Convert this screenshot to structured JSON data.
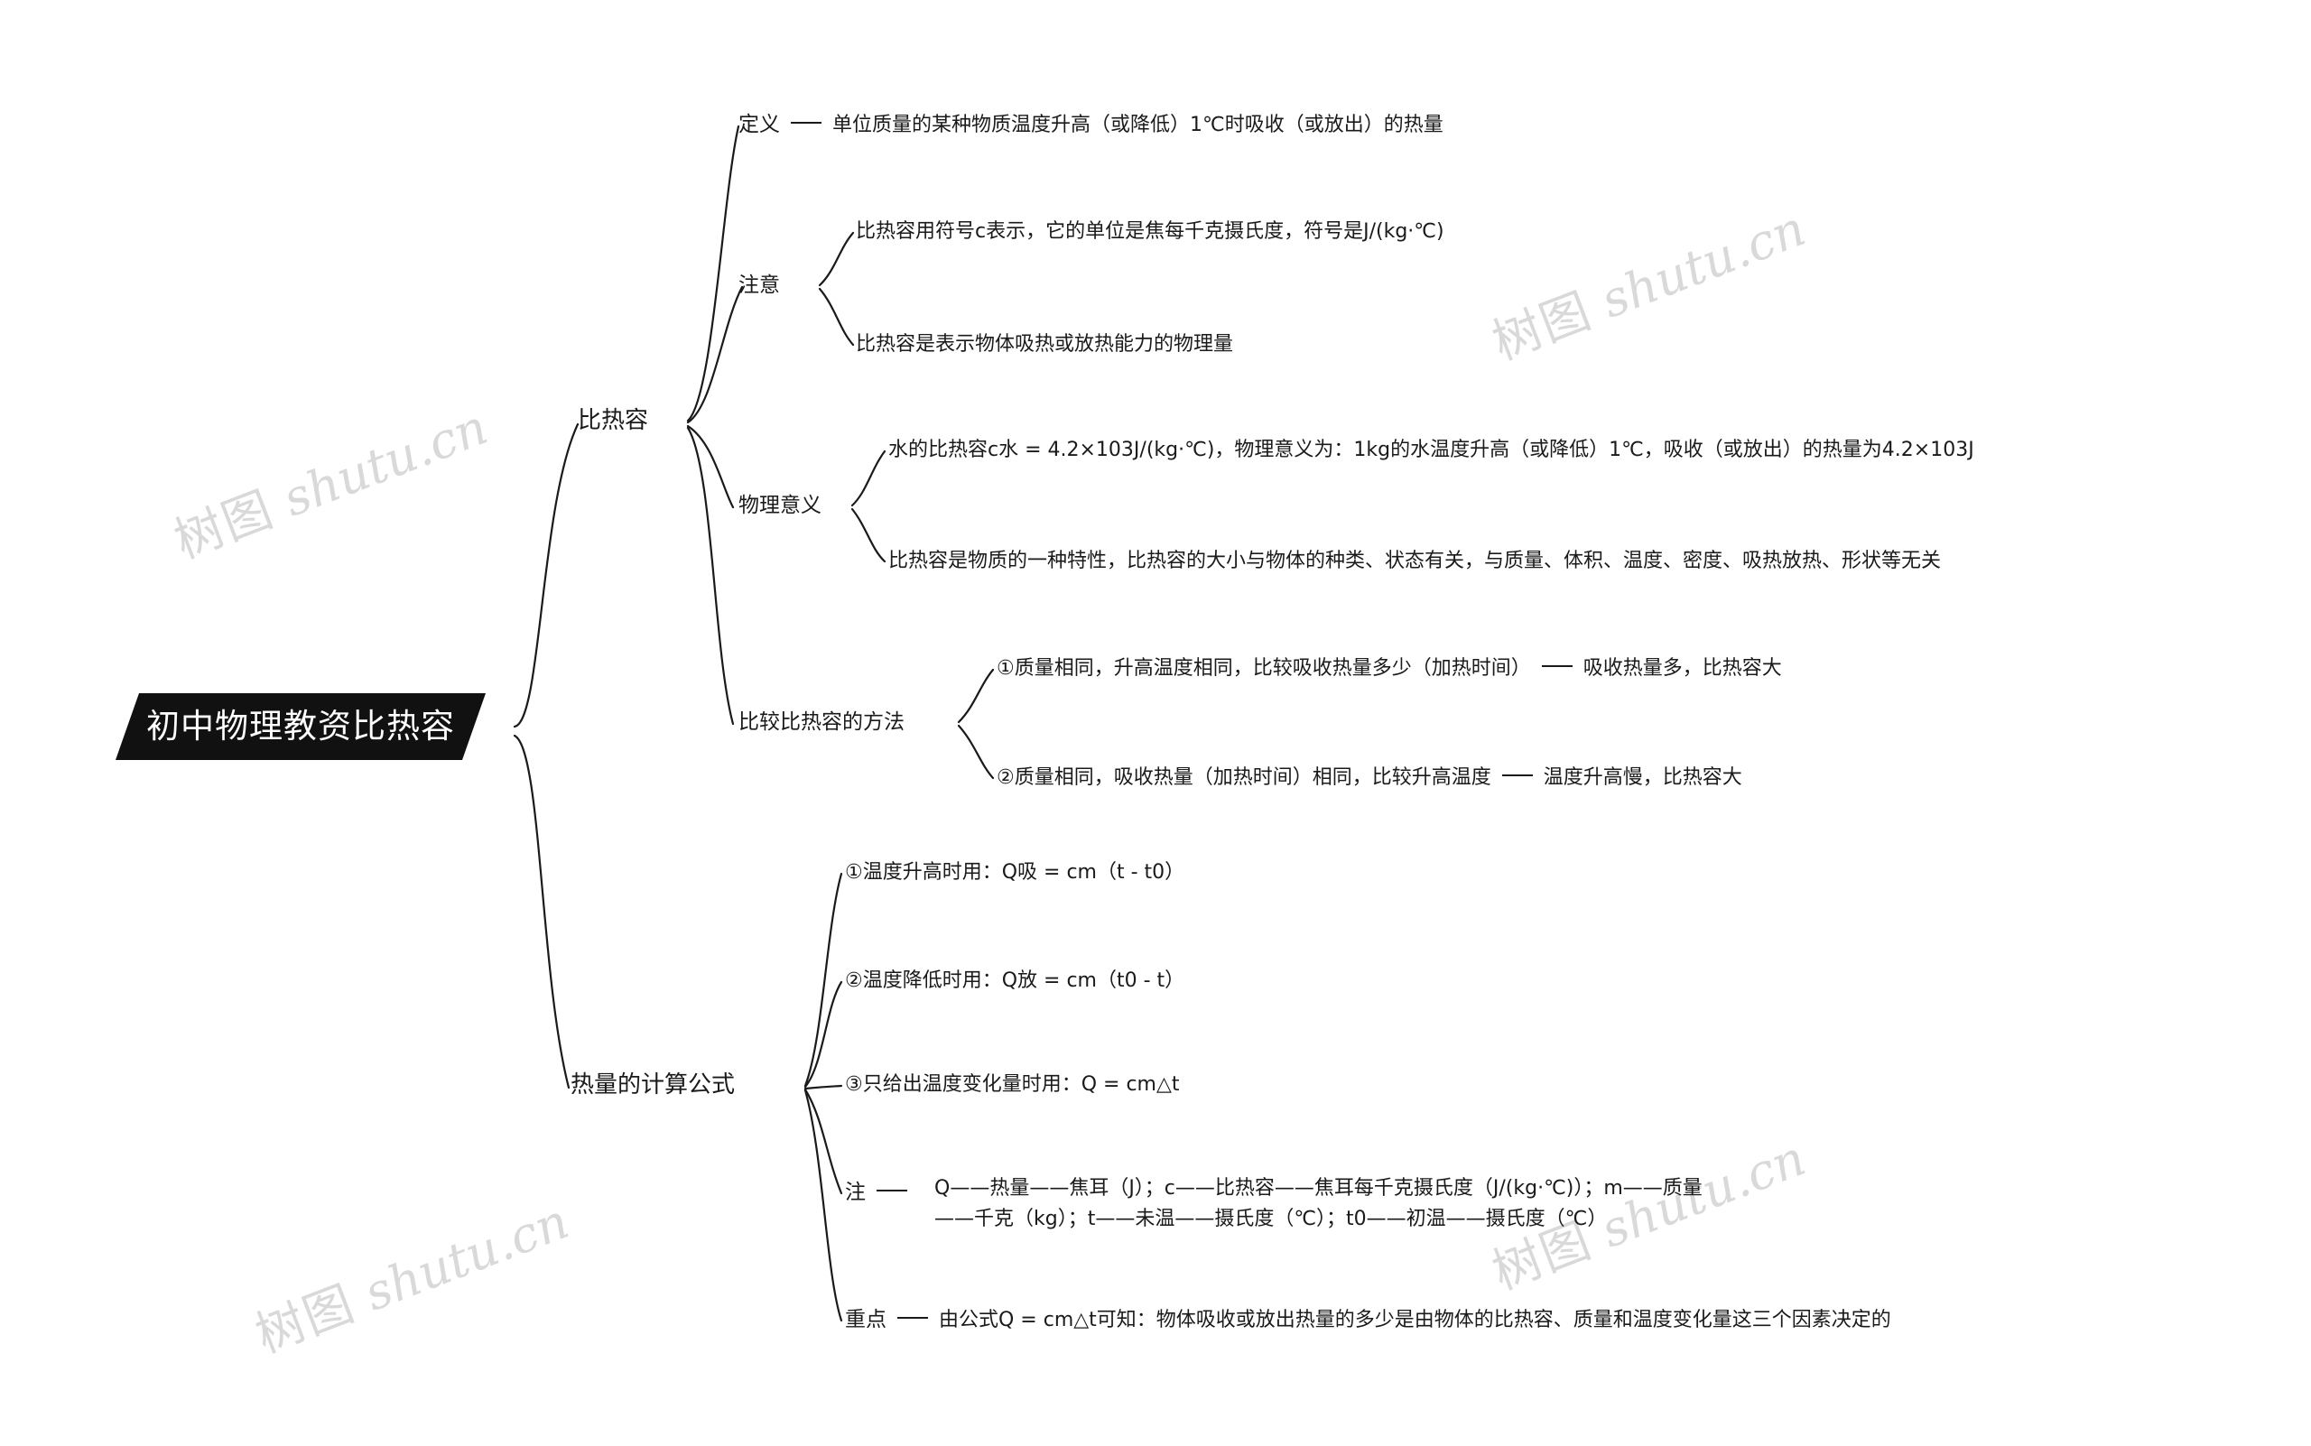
{
  "meta": {
    "watermark_text_cn": "树图",
    "watermark_text_en": "shutu.cn",
    "watermark_color": "#d9d9d9",
    "background_color": "#ffffff",
    "line_color": "#1a1a1a",
    "root_fill": "#111111",
    "root_text_color": "#ffffff"
  },
  "root": {
    "label": "初中物理教资比热容"
  },
  "branches": [
    {
      "label": "比热容",
      "children": [
        {
          "label": "定义",
          "connector": "dash",
          "detail": "单位质量的某种物质温度升高（或降低）1℃时吸收（或放出）的热量"
        },
        {
          "label": "注意",
          "connector": "fork",
          "items": [
            "比热容用符号c表示，它的单位是焦每千克摄氏度，符号是J/(kg·℃)",
            "比热容是表示物体吸热或放热能力的物理量"
          ]
        },
        {
          "label": "物理意义",
          "connector": "fork",
          "items": [
            "水的比热容c水 = 4.2×103J/(kg·℃)，物理意义为：1kg的水温度升高（或降低）1℃，吸收（或放出）的热量为4.2×103J",
            "比热容是物质的一种特性，比热容的大小与物体的种类、状态有关，与质量、体积、温度、密度、吸热放热、形状等无关"
          ]
        },
        {
          "label": "比较比热容的方法",
          "connector": "fork",
          "items": [
            {
              "left": "①质量相同，升高温度相同，比较吸收热量多少（加热时间）",
              "right": "吸收热量多，比热容大"
            },
            {
              "left": "②质量相同，吸收热量（加热时间）相同，比较升高温度",
              "right": "温度升高慢，比热容大"
            }
          ]
        }
      ]
    },
    {
      "label": "热量的计算公式",
      "children": [
        {
          "label": "①温度升高时用：Q吸 = cm（t - t0）"
        },
        {
          "label": "②温度降低时用：Q放 = cm（t0 - t）"
        },
        {
          "label": "③只给出温度变化量时用：Q = cm△t"
        },
        {
          "label": "注",
          "connector": "dash",
          "detail_line1": "Q——热量——焦耳（J）；c——比热容——焦耳每千克摄氏度（J/(kg·℃)）；m——质量",
          "detail_line2": "——千克（kg）；t——未温——摄氏度（℃）；t0——初温——摄氏度（℃）"
        },
        {
          "label": "重点",
          "connector": "dash",
          "detail": "由公式Q = cm△t可知：物体吸收或放出热量的多少是由物体的比热容、质量和温度变化量这三个因素决定的"
        }
      ]
    }
  ]
}
